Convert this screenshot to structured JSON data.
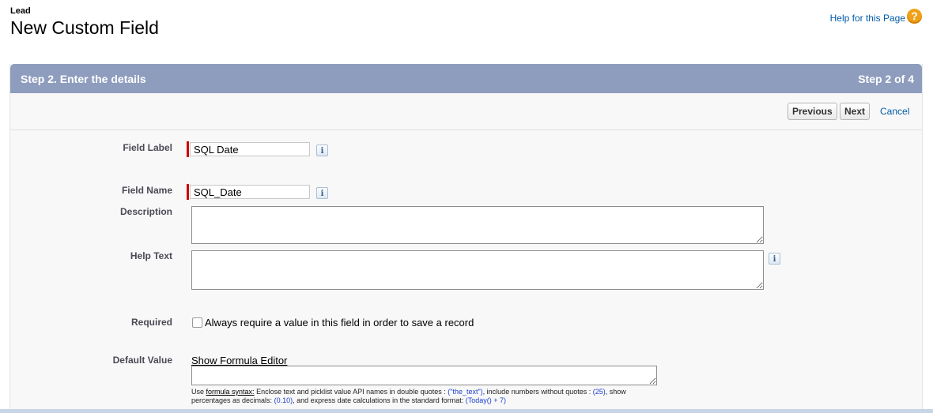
{
  "header": {
    "entity": "Lead",
    "title": "New Custom Field",
    "help_link": "Help for this Page",
    "help_icon": "?"
  },
  "step": {
    "title": "Step 2. Enter the details",
    "count": "Step 2 of 4"
  },
  "buttons": {
    "previous": "Previous",
    "next": "Next",
    "cancel": "Cancel"
  },
  "fields": {
    "field_label": {
      "label": "Field Label",
      "value": "SQL Date"
    },
    "field_name": {
      "label": "Field Name",
      "value": "SQL_Date"
    },
    "description": {
      "label": "Description"
    },
    "help_text": {
      "label": "Help Text"
    },
    "required": {
      "label": "Required",
      "checkbox_text": "Always require a value in this field in order to save a record"
    },
    "default_value": {
      "label": "Default Value",
      "formula_link": "Show Formula Editor",
      "note_use": "Use",
      "note_syntax_link": "formula syntax:",
      "note_part1": "Enclose text and picklist value API names in double quotes :",
      "note_example1": "(\"the_text\")",
      "note_part2": ", include numbers without quotes :",
      "note_example2": "(25)",
      "note_part3": ", show percentages as decimals:",
      "note_example3": "(0.10)",
      "note_part4": ", and express date calculations in the standard format:",
      "note_example4": "(Today() + 7)"
    }
  },
  "icons": {
    "info": "i"
  },
  "colors": {
    "step_bar": "#8e9dbe",
    "required_marker": "#cc0000",
    "link": "#015ba7",
    "help_icon": "#f0a018"
  }
}
